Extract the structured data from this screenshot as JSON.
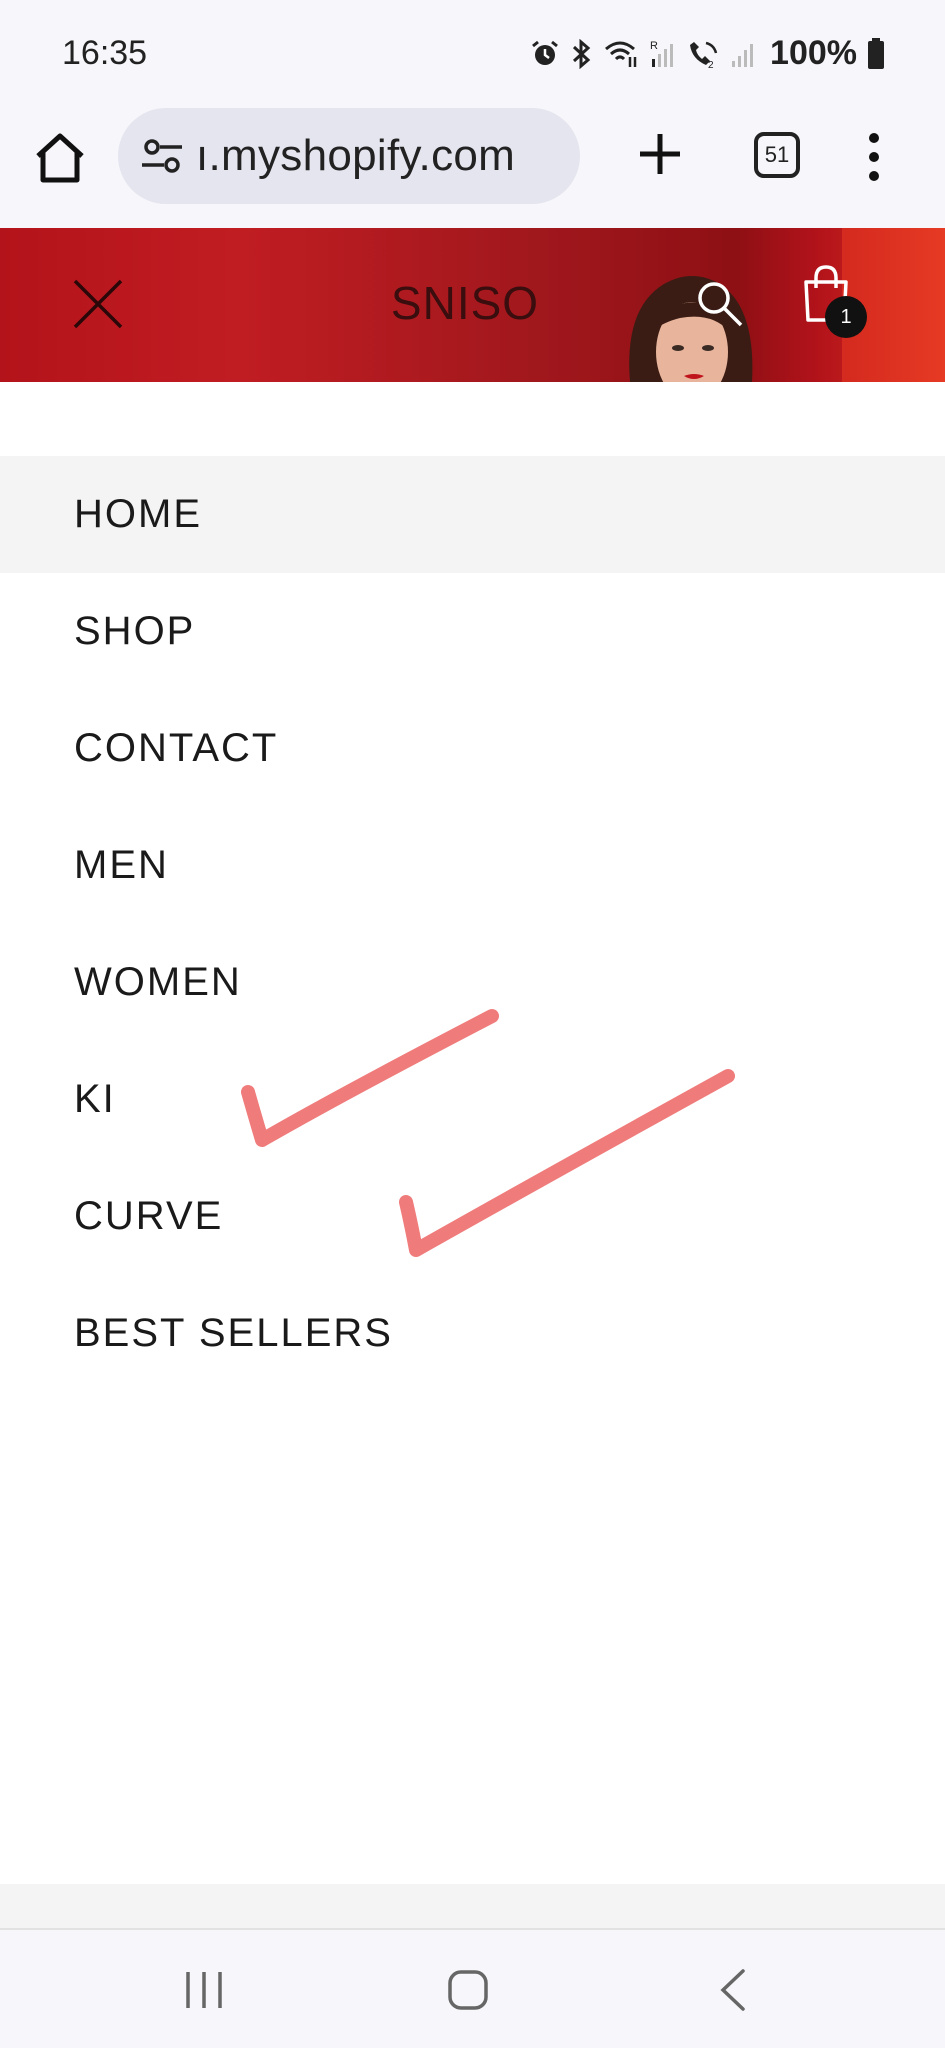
{
  "status_bar": {
    "time": "16:35",
    "battery": "100%",
    "icons": [
      "alarm-icon",
      "bluetooth-icon",
      "wifi-calling-icon",
      "signal-icon",
      "wifi-calling-2-icon",
      "signal-2-icon",
      "battery-icon"
    ]
  },
  "browser": {
    "url": "ı.myshopify.com",
    "tab_count": "51"
  },
  "header": {
    "brand": "SNISO",
    "cart_count": "1",
    "colors": {
      "header_red": "#b3131a",
      "accent_red": "#e03321"
    }
  },
  "menu": {
    "items": [
      {
        "label": "HOME",
        "active": true
      },
      {
        "label": "SHOP",
        "active": false
      },
      {
        "label": "CONTACT",
        "active": false
      },
      {
        "label": "MEN",
        "active": false
      },
      {
        "label": "WOMEN",
        "active": false
      },
      {
        "label": "KI",
        "active": false
      },
      {
        "label": "CURVE",
        "active": false
      },
      {
        "label": "BEST SELLERS",
        "active": false
      }
    ]
  },
  "annotations": {
    "checkmark_color": "#f07b7b",
    "checkmarks_next_to": [
      "KI",
      "CURVE"
    ]
  },
  "nav_bar": {
    "buttons": [
      "recents-icon",
      "home-icon",
      "back-icon"
    ]
  }
}
